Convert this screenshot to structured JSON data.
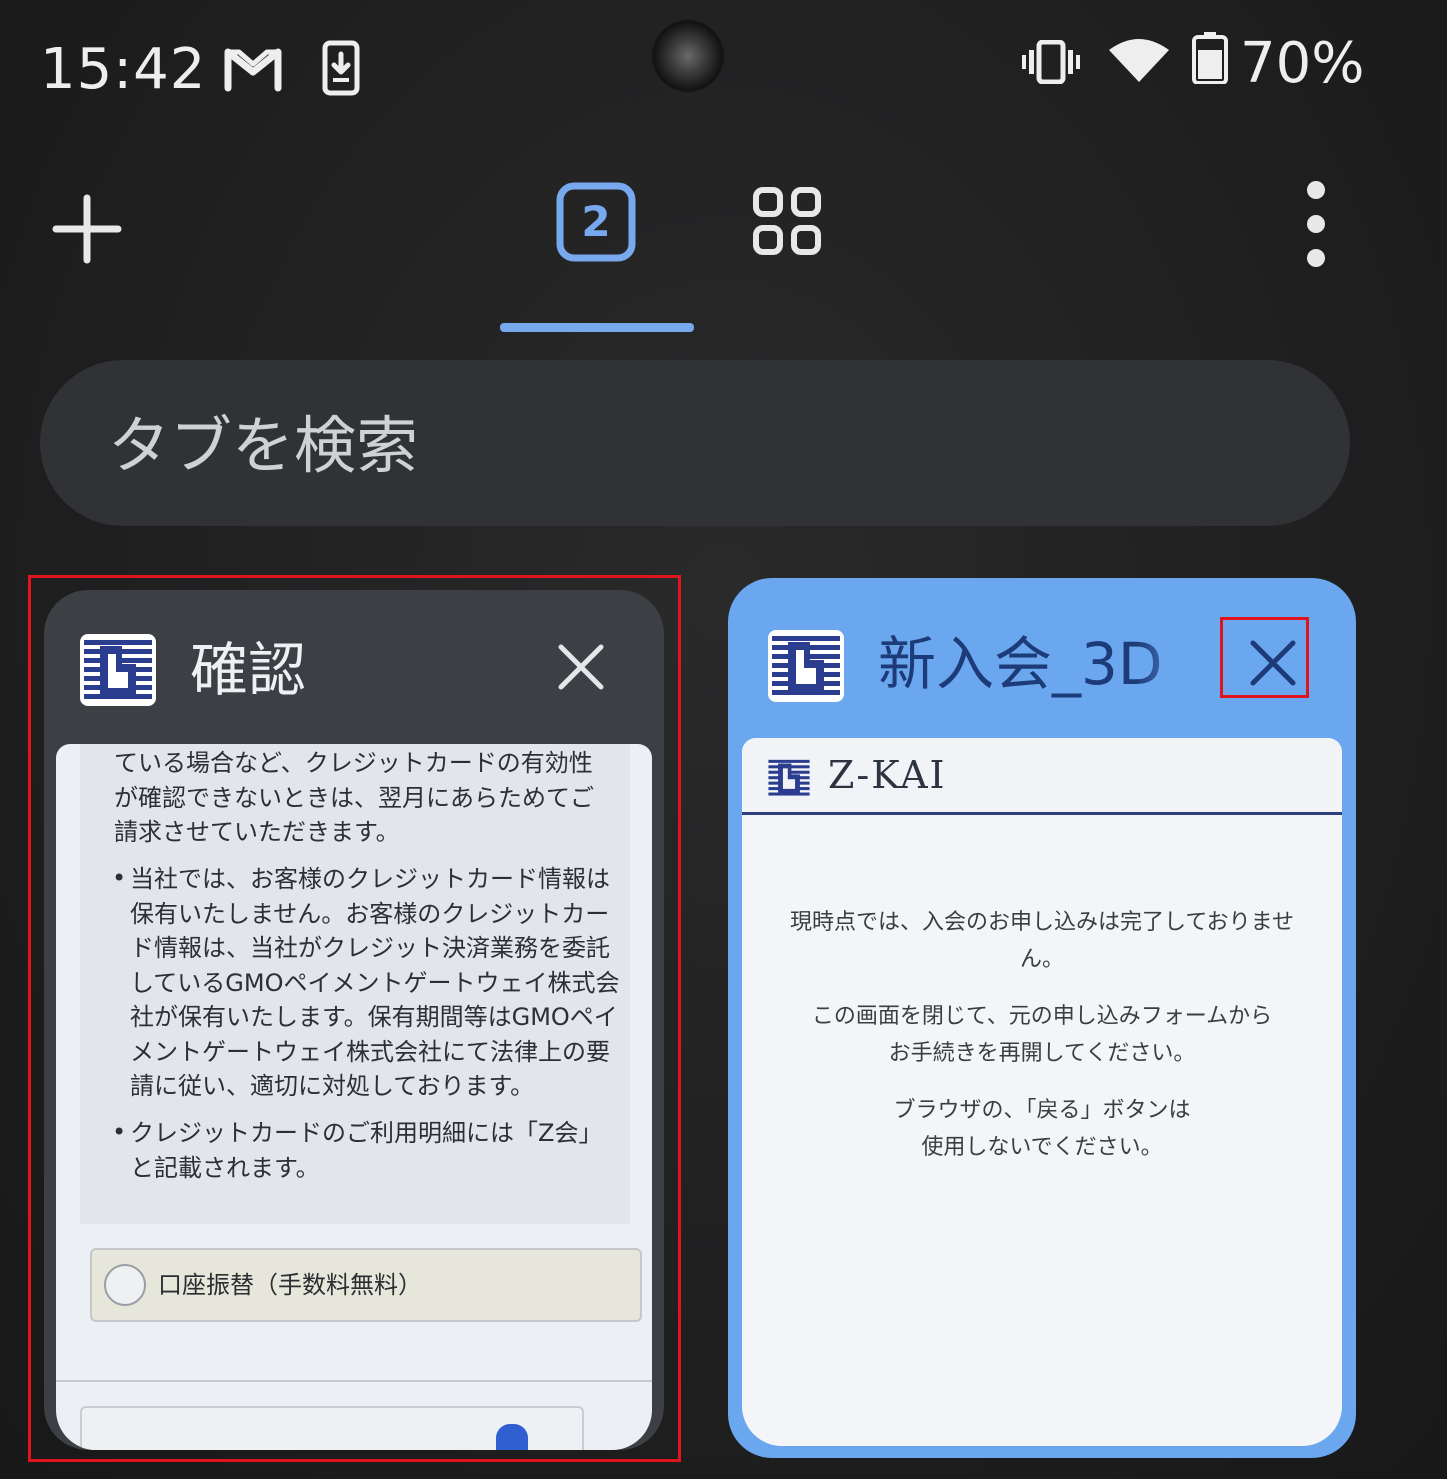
{
  "status_bar": {
    "time": "15:42",
    "battery_percent": "70%",
    "icons": [
      "gmail-icon",
      "download-icon",
      "vibrate-icon",
      "wifi-icon",
      "battery-icon"
    ]
  },
  "toolbar": {
    "tab_count": "2",
    "new_tab_icon": "plus-icon",
    "tab_groups_icon": "grid-icon",
    "menu_icon": "more-vert-icon",
    "accent_color": "#78a8ee"
  },
  "search": {
    "placeholder": "タブを検索"
  },
  "tabs": [
    {
      "title": "確認",
      "favicon": "zkai-logo-icon",
      "selected": false,
      "thumbnail": {
        "lines_block1": [
          "ている場合など、クレジットカードの有効性",
          "が確認できないときは、翌月にあらためてご",
          "請求させていただきます。"
        ],
        "lines_block2": [
          "当社では、お客様のクレジットカード情報は",
          "保有いたしません。お客様のクレジットカー",
          "ド情報は、当社がクレジット決済業務を委託",
          "しているGMOペイメントゲートウェイ株式会",
          "社が保有いたします。保有期間等はGMOペイ",
          "メントゲートウェイ株式会社にて法律上の要",
          "請に従い、適切に対処しております。"
        ],
        "lines_block3": [
          "クレジットカードのご利用明細には「Z会」",
          "と記載されます。"
        ],
        "radio_label": "口座振替（手数料無料）"
      }
    },
    {
      "title": "新入会_3D",
      "favicon": "zkai-logo-icon",
      "selected": true,
      "card_color": "#6aa7ef",
      "thumbnail": {
        "brand": "Z-KAI",
        "notice_lines": [
          "現時点では、入会のお申し込みは完了しておりませ",
          "ん。",
          "",
          "この画面を閉じて、元の申し込みフォームから",
          "お手続きを再開してください。",
          "",
          "ブラウザの、「戻る」ボタンは",
          "使用しないでください。"
        ]
      }
    }
  ]
}
